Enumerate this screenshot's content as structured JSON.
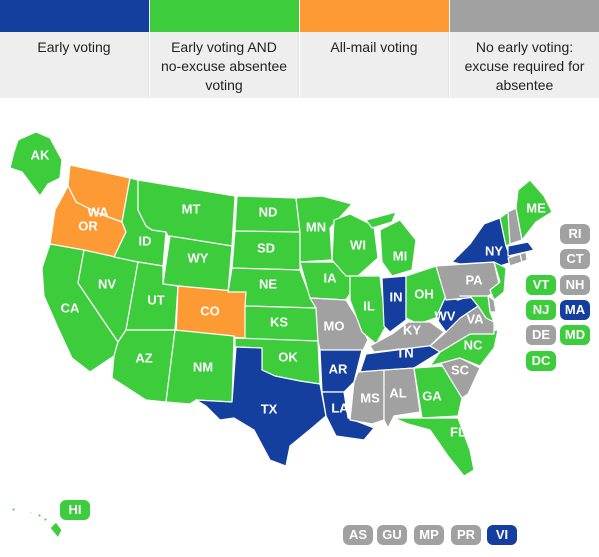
{
  "colors": {
    "early": "#143f9f",
    "early_noexcuse": "#3ccc3c",
    "allmail": "#fe9a34",
    "none": "#a1a1a1"
  },
  "legend": [
    {
      "key": "early",
      "label": "Early voting"
    },
    {
      "key": "early_noexcuse",
      "label": "Early voting AND no-excuse absentee voting"
    },
    {
      "key": "allmail",
      "label": "All-mail voting"
    },
    {
      "key": "none",
      "label": "No early voting: excuse required for absentee"
    }
  ],
  "states": {
    "AK": "early_noexcuse",
    "WA": "allmail",
    "OR": "allmail",
    "CA": "early_noexcuse",
    "NV": "early_noexcuse",
    "ID": "early_noexcuse",
    "MT": "early_noexcuse",
    "WY": "early_noexcuse",
    "UT": "early_noexcuse",
    "AZ": "early_noexcuse",
    "CO": "allmail",
    "NM": "early_noexcuse",
    "ND": "early_noexcuse",
    "SD": "early_noexcuse",
    "NE": "early_noexcuse",
    "KS": "early_noexcuse",
    "OK": "early_noexcuse",
    "TX": "early",
    "MN": "early_noexcuse",
    "IA": "early_noexcuse",
    "MO": "none",
    "AR": "early",
    "LA": "early",
    "WI": "early_noexcuse",
    "IL": "early_noexcuse",
    "MI": "early_noexcuse",
    "IN": "early",
    "OH": "early_noexcuse",
    "KY": "none",
    "TN": "early",
    "MS": "none",
    "AL": "none",
    "GA": "early_noexcuse",
    "FL": "early_noexcuse",
    "SC": "none",
    "NC": "early_noexcuse",
    "VA": "none",
    "WV": "early",
    "PA": "none",
    "NY": "early",
    "ME": "early_noexcuse",
    "VT": "early_noexcuse",
    "NH": "none",
    "MA": "early",
    "RI": "none",
    "CT": "none",
    "NJ": "early_noexcuse",
    "DE": "none",
    "MD": "early_noexcuse",
    "DC": "early_noexcuse",
    "HI": "early_noexcuse"
  },
  "chips_northeast": [
    {
      "code": "RI"
    },
    {
      "code": "CT"
    },
    {
      "code": "VT"
    },
    {
      "code": "NH"
    },
    {
      "code": "NJ"
    },
    {
      "code": "MA"
    },
    {
      "code": "DE"
    },
    {
      "code": "MD"
    },
    {
      "code": "DC"
    }
  ],
  "chips_territories": [
    {
      "code": "AS",
      "key": "none"
    },
    {
      "code": "GU",
      "key": "none"
    },
    {
      "code": "MP",
      "key": "none"
    },
    {
      "code": "PR",
      "key": "none"
    },
    {
      "code": "VI",
      "key": "early"
    }
  ],
  "hi_chip": {
    "code": "HI"
  }
}
